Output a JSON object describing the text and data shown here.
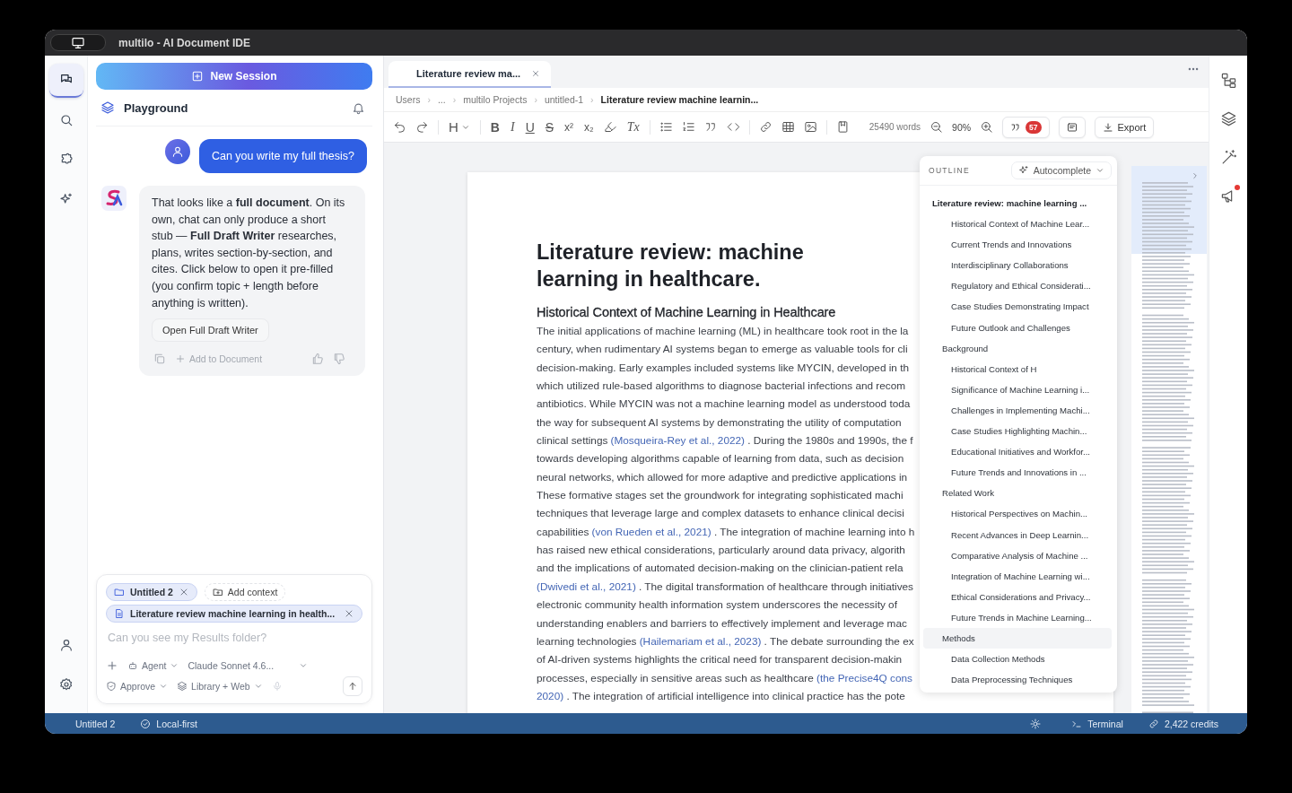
{
  "window": {
    "title": "multilo - AI Document IDE"
  },
  "rail": [
    {
      "selected": true
    },
    {
      "selected": false
    },
    {
      "selected": false
    },
    {
      "selected": false
    },
    {
      "selected": false
    },
    {
      "selected": false
    }
  ],
  "chat": {
    "new_session": "New Session",
    "header": "Playground",
    "messages": [
      {
        "kind": "user",
        "text": "Can you write my full thesis?"
      },
      {
        "kind": "assistant",
        "text": "That looks like a **full document**. On its own, chat can only produce a short stub — **Full Draft Writer** researches, plans, writes section-by-section, and cites. Click below to open it pre-filled (you confirm topic + length before anything is written).",
        "action": "Open Full Draft Writer",
        "add": "Add to Document"
      }
    ],
    "composer": {
      "folder_chip": "Untitled 2",
      "add_context": "Add context",
      "document_chip": "Literature review machine learning in health...",
      "placeholder": "Can you see my Results folder?",
      "mode": "Agent",
      "model": "Claude Sonnet 4.6...",
      "approval": "Approve",
      "sources": "Library + Web"
    }
  },
  "tabs": [
    {
      "label": "Literature review ma...",
      "selected": true
    }
  ],
  "breadcrumb_separator": "›",
  "breadcrumb": [
    "Users",
    "...",
    "multilo Projects",
    "untitled-1",
    "Literature review machine learnin..."
  ],
  "toolbar": {
    "heading": "H",
    "formats": [
      {
        "glyph": "B",
        "kind": "bold"
      },
      {
        "glyph": "I",
        "kind": "italic"
      },
      {
        "glyph": "U",
        "kind": "underline"
      },
      {
        "glyph": "S",
        "kind": "strike"
      },
      {
        "glyph": "x²",
        "kind": "plain"
      },
      {
        "glyph": "x₂",
        "kind": "plain"
      }
    ],
    "clear": "Tx",
    "words": "25490 words",
    "zoom": "90%",
    "citations": "57",
    "export": "Export"
  },
  "document": {
    "title": "Literature review: machine learning in healthcare.",
    "heading": "Historical Context of Machine Learning in Healthcare",
    "lines": [
      [
        {
          "text": "The initial applications of machine learning (ML) in healthcare took root in the la",
          "cite": false
        }
      ],
      [
        {
          "text": "century, when rudimentary AI systems began to emerge as valuable tools for cli",
          "cite": false
        }
      ],
      [
        {
          "text": "decision-making. Early examples included systems like MYCIN, developed in th",
          "cite": false
        }
      ],
      [
        {
          "text": "which utilized rule-based algorithms to diagnose bacterial infections and recom",
          "cite": false
        }
      ],
      [
        {
          "text": "antibiotics. While MYCIN was not a machine learning model as understood toda",
          "cite": false
        }
      ],
      [
        {
          "text": "the way for subsequent AI systems by demonstrating the utility of computation",
          "cite": false
        }
      ],
      [
        {
          "text": "clinical settings",
          "cite": false
        },
        {
          "text": "(Mosqueira-Rey et al., 2022)",
          "cite": true
        },
        {
          "text": ". During the 1980s and 1990s, the f",
          "cite": false
        }
      ],
      [
        {
          "text": "towards developing algorithms capable of learning from data, such as decision",
          "cite": false
        }
      ],
      [
        {
          "text": "neural networks, which allowed for more adaptive and predictive applications in",
          "cite": false
        }
      ],
      [
        {
          "text": "These formative stages set the groundwork for integrating sophisticated machi",
          "cite": false
        }
      ],
      [
        {
          "text": "techniques that leverage large and complex datasets to enhance clinical decisi",
          "cite": false
        }
      ],
      [
        {
          "text": "capabilities",
          "cite": false
        },
        {
          "text": "(von Rueden et al., 2021)",
          "cite": true
        },
        {
          "text": ". The integration of machine learning into h",
          "cite": false
        }
      ],
      [
        {
          "text": "has raised new ethical considerations, particularly around data privacy, algorith",
          "cite": false
        }
      ],
      [
        {
          "text": "and the implications of automated decision-making on the clinician-patient rela",
          "cite": false
        }
      ],
      [
        {
          "text": "(Dwivedi et al., 2021)",
          "cite": true
        },
        {
          "text": ". The digital transformation of healthcare through initiatives",
          "cite": false
        }
      ],
      [
        {
          "text": "electronic community health information system underscores the necessity of",
          "cite": false
        }
      ],
      [
        {
          "text": "understanding enablers and barriers to effectively implement and leverage mac",
          "cite": false
        }
      ],
      [
        {
          "text": "learning technologies",
          "cite": false
        },
        {
          "text": "(Hailemariam et al., 2023)",
          "cite": true
        },
        {
          "text": ". The debate surrounding the ex",
          "cite": false
        }
      ],
      [
        {
          "text": "of AI-driven systems highlights the critical need for transparent decision-makin",
          "cite": false
        }
      ],
      [
        {
          "text": "processes, especially in sensitive areas such as healthcare",
          "cite": false
        },
        {
          "text": "(the Precise4Q cons",
          "cite": true
        }
      ],
      [
        {
          "text": "2020)",
          "cite": true
        },
        {
          "text": ". The integration of artificial intelligence into clinical practice has the pote",
          "cite": false
        }
      ]
    ]
  },
  "outline": {
    "label": "OUTLINE",
    "autocomplete": "Autocomplete",
    "items": [
      {
        "label": "Literature review: machine learning ...",
        "kind": "title",
        "selected": false,
        "children": [
          {
            "label": "Historical Context of Machine Lear...",
            "kind": "subsection",
            "selected": false
          },
          {
            "label": "Current Trends and Innovations",
            "kind": "subsection",
            "selected": false
          },
          {
            "label": "Interdisciplinary Collaborations",
            "kind": "subsection",
            "selected": false
          },
          {
            "label": "Regulatory and Ethical Considerati...",
            "kind": "subsection",
            "selected": false
          },
          {
            "label": "Case Studies Demonstrating Impact",
            "kind": "subsection",
            "selected": false
          },
          {
            "label": "Future Outlook and Challenges",
            "kind": "subsection",
            "selected": false
          },
          {
            "label": "Background",
            "kind": "section",
            "selected": false,
            "children": [
              {
                "label": "Historical Context of H",
                "kind": "subsection",
                "selected": false
              },
              {
                "label": "Significance of Machine Learning i...",
                "kind": "subsection",
                "selected": false
              },
              {
                "label": "Challenges in Implementing Machi...",
                "kind": "subsection",
                "selected": false
              },
              {
                "label": "Case Studies Highlighting Machin...",
                "kind": "subsection",
                "selected": false
              },
              {
                "label": "Educational Initiatives and Workfor...",
                "kind": "subsection",
                "selected": false
              },
              {
                "label": "Future Trends and Innovations in ...",
                "kind": "subsection",
                "selected": false
              }
            ]
          },
          {
            "label": "Related Work",
            "kind": "section",
            "selected": false,
            "children": [
              {
                "label": "Historical Perspectives on Machin...",
                "kind": "subsection",
                "selected": false
              },
              {
                "label": "Recent Advances in Deep Learnin...",
                "kind": "subsection",
                "selected": false
              },
              {
                "label": "Comparative Analysis of Machine ...",
                "kind": "subsection",
                "selected": false
              },
              {
                "label": "Integration of Machine Learning wi...",
                "kind": "subsection",
                "selected": false
              },
              {
                "label": "Ethical Considerations and Privacy...",
                "kind": "subsection",
                "selected": false
              },
              {
                "label": "Future Trends in Machine Learning...",
                "kind": "subsection",
                "selected": false
              }
            ]
          },
          {
            "label": "Methods",
            "kind": "section",
            "selected": true,
            "children": [
              {
                "label": "Data Collection Methods",
                "kind": "subsection",
                "selected": false
              },
              {
                "label": "Data Preprocessing Techniques",
                "kind": "subsection",
                "selected": false
              }
            ]
          }
        ]
      }
    ]
  },
  "status_bar": {
    "document": "Untitled 2",
    "mode": "Local-first",
    "terminal": "Terminal",
    "credits": "2,422 credits"
  }
}
